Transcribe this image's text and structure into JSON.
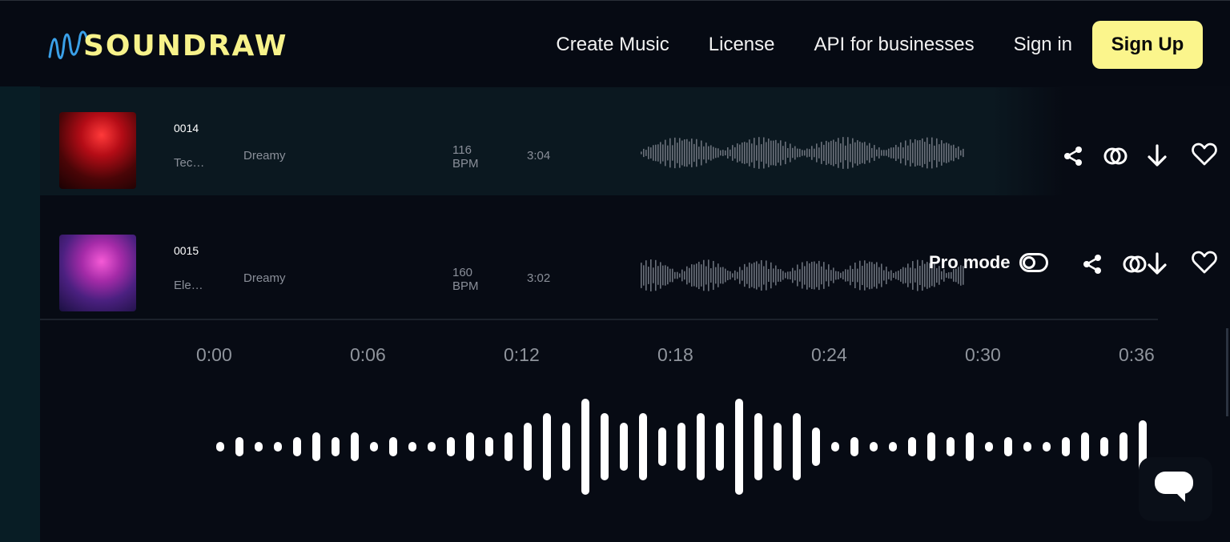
{
  "header": {
    "logo_text": "SOUNDRAW",
    "nav": [
      "Create Music",
      "License",
      "API for businesses",
      "Sign in"
    ],
    "signup_label": "Sign Up",
    "colors": {
      "accent": "#fbf58c",
      "logo_wave": "#3aa0e8"
    }
  },
  "tracks": [
    {
      "id": "0014",
      "genre": "Tec…",
      "mood": "Dreamy",
      "bpm_value": "116",
      "bpm_unit": "BPM",
      "duration": "3:04",
      "thumb_color": "#b40c16"
    },
    {
      "id": "0015",
      "genre": "Ele…",
      "mood": "Dreamy",
      "bpm_value": "160",
      "bpm_unit": "BPM",
      "duration": "3:02",
      "thumb_color": "#a52ba8"
    }
  ],
  "actions": {
    "icons": [
      "share-icon",
      "link-icon",
      "download-icon",
      "heart-icon"
    ]
  },
  "pro_mode": {
    "label": "Pro mode",
    "enabled": false
  },
  "timeline": {
    "labels": [
      "0:00",
      "0:06",
      "0:12",
      "0:18",
      "0:24",
      "0:30",
      "0:36"
    ]
  },
  "waveform": {
    "levels": [
      0.1,
      0.2,
      0.1,
      0.1,
      0.2,
      0.3,
      0.2,
      0.3,
      0.1,
      0.2,
      0.1,
      0.1,
      0.2,
      0.3,
      0.2,
      0.3,
      0.5,
      0.7,
      0.5,
      1.0,
      0.7,
      0.5,
      0.7,
      0.4,
      0.5,
      0.7,
      0.5,
      1.0,
      0.7,
      0.5,
      0.7,
      0.4,
      0.1,
      0.2,
      0.1,
      0.1,
      0.2,
      0.3,
      0.2,
      0.3,
      0.1,
      0.2,
      0.1,
      0.1,
      0.2,
      0.3,
      0.2,
      0.3,
      0.55
    ]
  },
  "chat": {
    "icon": "chat-icon"
  }
}
